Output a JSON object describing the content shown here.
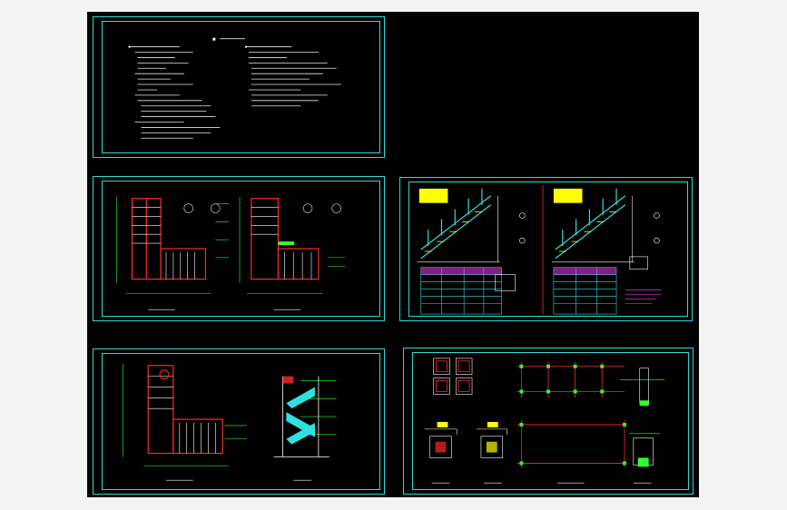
{
  "drawing": {
    "colors": {
      "background": "#000000",
      "frame": "#2fd8d8",
      "wall": "#ff2a2a",
      "line": "#ffffff",
      "dimension": "#30ff30",
      "highlight": "#2fe0e0",
      "accent": "#ffff00",
      "magenta": "#ff40ff"
    },
    "sheets": [
      {
        "id": "notes",
        "content": "design-notes-text"
      },
      {
        "id": "plan-left",
        "content": "stair-plans"
      },
      {
        "id": "steel-stair",
        "content": "steel-stair-elevations"
      },
      {
        "id": "plan-bottom",
        "content": "floor-plan-and-section"
      },
      {
        "id": "foundation",
        "content": "foundation-details"
      }
    ]
  }
}
